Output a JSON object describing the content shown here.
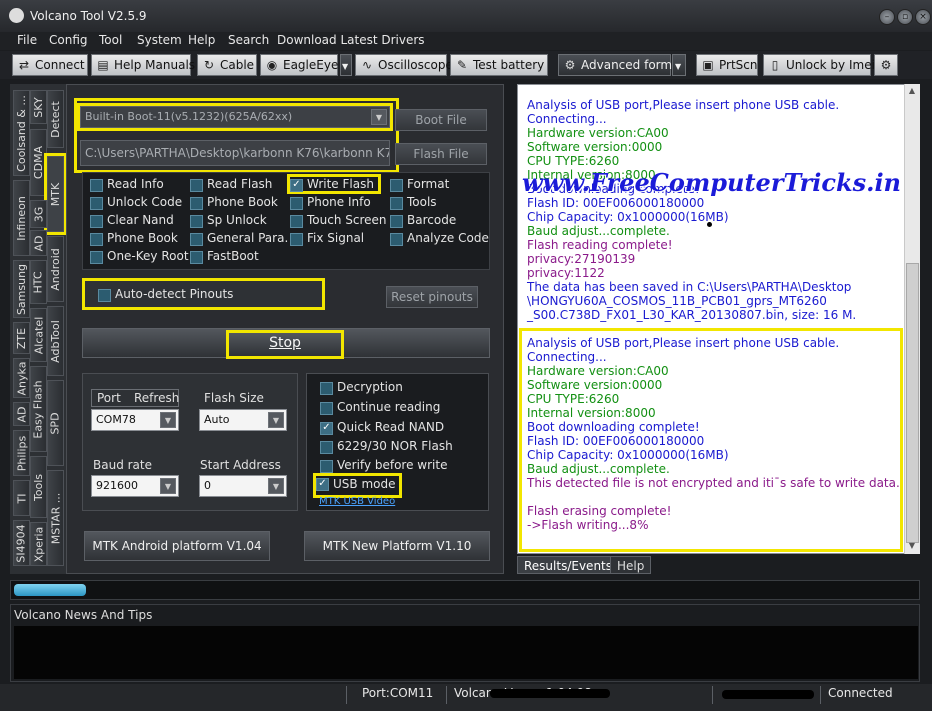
{
  "window": {
    "title": "Volcano Tool V2.5.9"
  },
  "menu": [
    "File",
    "Config",
    "Tool",
    "System",
    "Help",
    "Search",
    "Download Latest Drivers"
  ],
  "toolbar": {
    "connect": "Connect",
    "help_manuals": "Help Manuals",
    "cable": "Cable",
    "eagleeye": "EagleEye",
    "oscilloscope": "Oscilloscope",
    "test_battery": "Test battery",
    "advanced_form": "Advanced form",
    "prtscn": "PrtScn",
    "unlock_by_imei": "Unlock by Imei"
  },
  "vtabs": {
    "col1": [
      "Coolsand & ...",
      "CDMA",
      "Infineon",
      "Samsung",
      "ZTE",
      "Anyka",
      "AD",
      "Philips",
      "TI",
      "SI4904"
    ],
    "col2": [
      "SKY",
      "Detect",
      "MTK",
      "3G",
      "AD",
      "HTC",
      "Android",
      "Alcatel",
      "AdbTool",
      "Easy Flash",
      "SPD",
      "Tools",
      "Xperia",
      "MSTAR ..."
    ]
  },
  "boot": {
    "select_value": "Built-in Boot-11(v5.1232)(625A/62xx)",
    "path_value": "C:\\Users\\PARTHA\\Desktop\\karbonn K76\\karbonn K76.",
    "boot_file_btn": "Boot File",
    "flash_file_btn": "Flash File"
  },
  "options": [
    [
      "Read Info",
      "Read Flash",
      "Write Flash",
      "Format"
    ],
    [
      "Unlock Code",
      "Phone Book",
      "Phone Info",
      "Tools"
    ],
    [
      "Clear Nand",
      "Sp Unlock",
      "Touch Screen",
      "Barcode"
    ],
    [
      "Phone Book",
      "General Para.",
      "Fix Signal",
      "Analyze Code"
    ],
    [
      "One-Key Root",
      "FastBoot"
    ]
  ],
  "auto_detect": "Auto-detect Pinouts",
  "reset_pinouts": "Reset pinouts",
  "stop_btn": "Stop",
  "port": {
    "label": "Port",
    "refresh": "Refresh",
    "value": "COM78"
  },
  "flash_size": {
    "label": "Flash Size",
    "value": "Auto"
  },
  "baud_rate": {
    "label": "Baud rate",
    "value": "921600"
  },
  "start_address": {
    "label": "Start Address",
    "value": "0"
  },
  "right_checks": [
    "Decryption",
    "Continue reading",
    "Quick Read NAND",
    "6229/30 NOR Flash",
    "Verify before write",
    "USB mode"
  ],
  "mtk_usb_video": "MTK USB Video",
  "platform_btns": {
    "android": "MTK Android platform V1.04",
    "new": "MTK New Platform V1.10"
  },
  "log_top": [
    {
      "t": "Analysis of USB port,Please insert phone USB cable.",
      "c": "blue"
    },
    {
      "t": "Connecting...",
      "c": "blue"
    },
    {
      "t": "Hardware version:CA00",
      "c": "green"
    },
    {
      "t": "Software version:0000",
      "c": "green"
    },
    {
      "t": "CPU TYPE:6260",
      "c": "green"
    },
    {
      "t": "Internal version:8000",
      "c": "green"
    },
    {
      "t": "Boot downloading complete!",
      "c": "blue"
    },
    {
      "t": "Flash ID: 00EF006000180000",
      "c": "blue"
    },
    {
      "t": "Chip Capacity: 0x1000000(16MB)",
      "c": "blue"
    },
    {
      "t": "Baud adjust...complete.",
      "c": "green"
    },
    {
      "t": "Flash reading complete!",
      "c": "purple"
    },
    {
      "t": "privacy:27190139",
      "c": "purple"
    },
    {
      "t": "privacy:1122",
      "c": "purple"
    },
    {
      "t": "The data has been saved in C:\\Users\\PARTHA\\Desktop",
      "c": "blue"
    },
    {
      "t": "\\HONGYU60A_COSMOS_11B_PCB01_gprs_MT6260",
      "c": "blue"
    },
    {
      "t": "_S00.C738D_FX01_L30_KAR_20130807.bin, size: 16 M.",
      "c": "blue"
    }
  ],
  "log_bottom": [
    {
      "t": "Analysis of USB port,Please insert phone USB cable.",
      "c": "blue"
    },
    {
      "t": "Connecting...",
      "c": "blue"
    },
    {
      "t": "Hardware version:CA00",
      "c": "green"
    },
    {
      "t": "Software version:0000",
      "c": "green"
    },
    {
      "t": "CPU TYPE:6260",
      "c": "green"
    },
    {
      "t": "Internal version:8000",
      "c": "green"
    },
    {
      "t": "Boot downloading complete!",
      "c": "blue"
    },
    {
      "t": "Flash ID: 00EF006000180000",
      "c": "blue"
    },
    {
      "t": "Chip Capacity: 0x1000000(16MB)",
      "c": "blue"
    },
    {
      "t": "Baud adjust...complete.",
      "c": "green"
    },
    {
      "t": "This detected file is not encrypted and iti¯s safe to write data.",
      "c": "purple"
    },
    {
      "t": "",
      "c": "purple"
    },
    {
      "t": "Flash erasing complete!",
      "c": "purple"
    },
    {
      "t": "->Flash writing...8%",
      "c": "purple"
    }
  ],
  "watermark": "www.FreeComputerTricks.in",
  "bottom_tabs": [
    "Results/Events",
    "Help"
  ],
  "progress_fraction": 0.08,
  "news_title": "Volcano News And Tips",
  "status": {
    "port": "Port:COM11",
    "version": "Volcano Ve...  ...1.04.08",
    "connected": "Connected"
  }
}
